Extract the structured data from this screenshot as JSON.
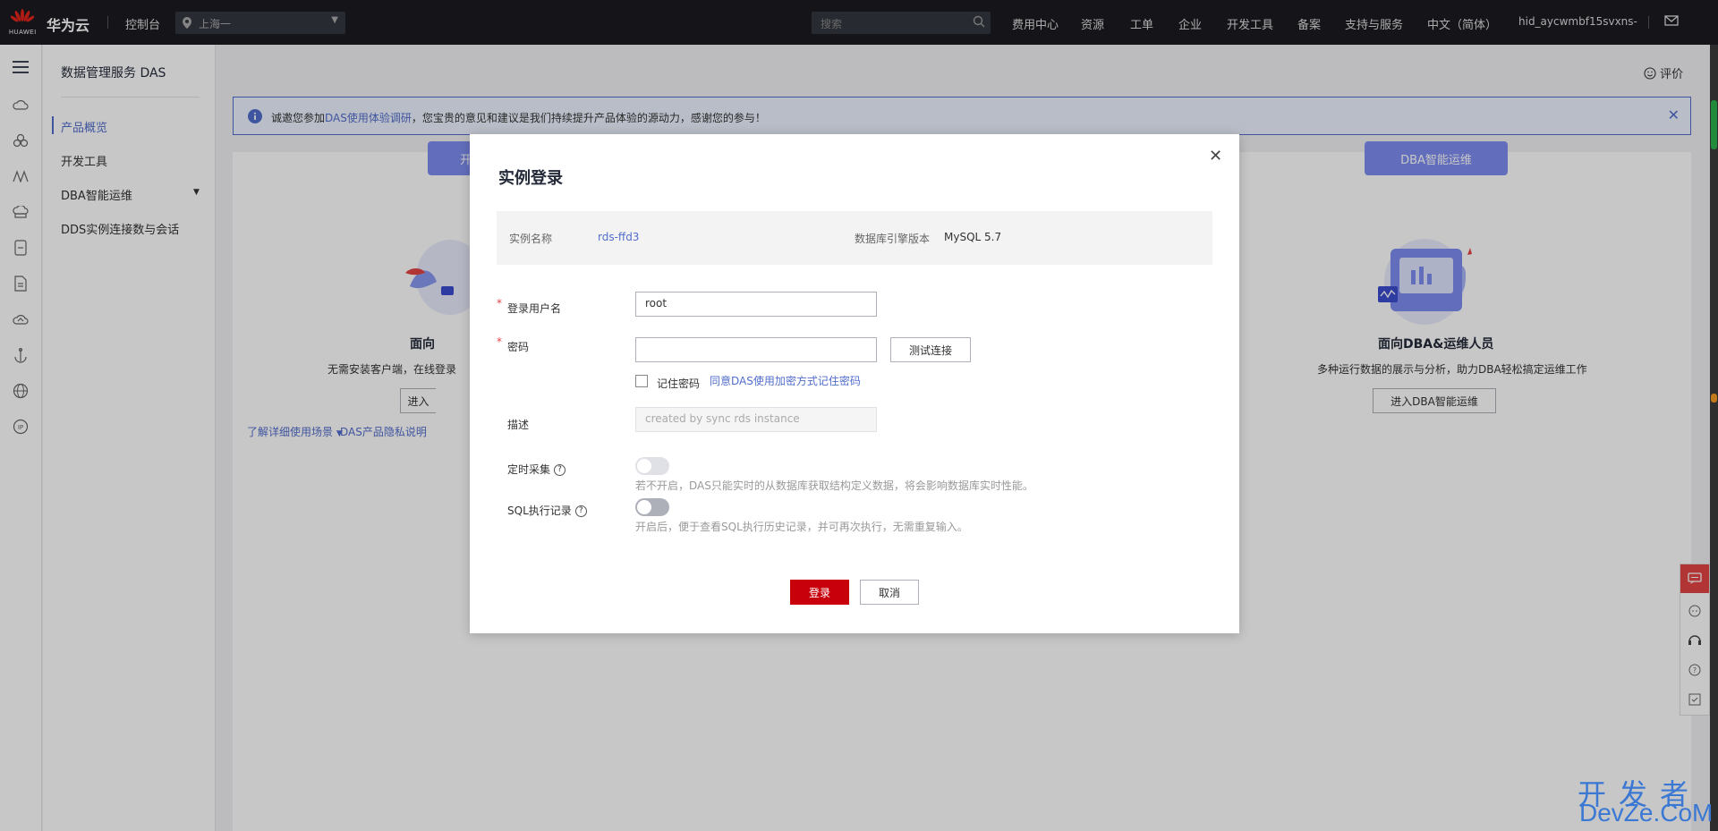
{
  "topbar": {
    "logo_word": "HUAWEI",
    "brand": "华为云",
    "console": "控制台",
    "region": "上海一",
    "search_placeholder": "搜索",
    "nav": [
      "费用中心",
      "资源",
      "工单",
      "企业",
      "开发工具",
      "备案",
      "支持与服务",
      "中文（简体）",
      "hid_aycwmbf15svxns-"
    ]
  },
  "sidebar": {
    "title": "数据管理服务 DAS",
    "items": [
      {
        "label": "产品概览",
        "active": true
      },
      {
        "label": "开发工具"
      },
      {
        "label": "DBA智能运维",
        "has_caret": true
      },
      {
        "label": "DDS实例连接数与会话"
      }
    ]
  },
  "main": {
    "rate": "评价",
    "banner": {
      "prefix": "诚邀您参加",
      "link": "DAS使用体验调研",
      "suffix": "，您宝贵的意见和建议是我们持续提升产品体验的源动力，感谢您的参与！"
    },
    "left_card": {
      "tab": "开",
      "title": "面向",
      "desc": "无需安装客户端，在线登录",
      "button": "进入"
    },
    "right_card": {
      "tab": "DBA智能运维",
      "title": "面向DBA&运维人员",
      "desc": "多种运行数据的展示与分析，助力DBA轻松搞定运维工作",
      "button": "进入DBA智能运维"
    },
    "links": {
      "scenarios": "了解详细使用场景",
      "privacy": "DAS产品隐私说明"
    }
  },
  "modal": {
    "title": "实例登录",
    "instance_label": "实例名称",
    "instance_value": "rds-ffd3",
    "engine_label": "数据库引擎版本",
    "engine_value": "MySQL 5.7",
    "username_label": "登录用户名",
    "username_value": "root",
    "password_label": "密码",
    "password_value": "",
    "test_button": "测试连接",
    "remember_label": "记住密码",
    "remember_checked": false,
    "remember_link": "同意DAS使用加密方式记住密码",
    "desc_label": "描述",
    "desc_placeholder": "created by sync rds instance",
    "schedule_label": "定时采集",
    "schedule_hint": "若不开启，DAS只能实时的从数据库获取结构定义数据，将会影响数据库实时性能。",
    "schedule_enabled": false,
    "sqllog_label": "SQL执行记录",
    "sqllog_hint": "开启后，便于查看SQL执行历史记录，并可再次执行，无需重复输入。",
    "sqllog_enabled": false,
    "login_button": "登录",
    "cancel_button": "取消"
  },
  "watermark": {
    "line1": "开发者",
    "line2": "DevZe.CoM"
  },
  "colors": {
    "brand_red": "#c7000b",
    "link_blue": "#526ecc",
    "topbar": "#1b1c21",
    "accent_purple": "#7e8ef0"
  }
}
